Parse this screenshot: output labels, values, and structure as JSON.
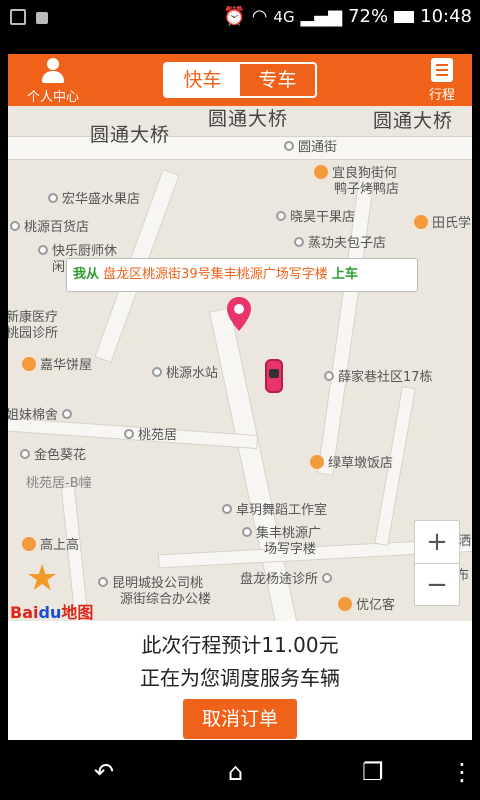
{
  "status_bar": {
    "network": "4G",
    "battery": "72%",
    "time": "10:48"
  },
  "header": {
    "profile_label": "个人中心",
    "trips_label": "行程",
    "tabs": [
      {
        "label": "快车",
        "active": true
      },
      {
        "label": "专车",
        "active": false
      }
    ],
    "accent_color": "#f0621a"
  },
  "map": {
    "road_labels": [
      "圆通大桥",
      "圆通大桥",
      "圆通大桥"
    ],
    "pois": [
      "圆通街",
      "宜良狗街何",
      "鸭子烤鸭店",
      "宏华盛水果店",
      "晓昊干果店",
      "田氏学",
      "桃源百货店",
      "蒸功夫包子店",
      "快乐厨师休",
      "闲",
      "新康医疗",
      "桃园诊所",
      "嘉华饼屋",
      "桃源水站",
      "薛家巷社区17栋",
      "姐妹棉舍",
      "桃苑居",
      "金色葵花",
      "绿草墩饭店",
      "桃苑居-B幢",
      "卓玥舞蹈工作室",
      "集丰桃源广",
      "场写字楼",
      "高上高",
      "昆明城投公司桃",
      "源街综合办公楼",
      "盘龙杨途诊所",
      "优亿客",
      "布",
      "洒"
    ],
    "pickup": {
      "prefix": "我从",
      "address": "盘龙区桃源街39号集丰桃源广场写字楼",
      "suffix": "上车"
    },
    "zoom_in": "+",
    "zoom_out": "−",
    "logo": {
      "bai": "Bai",
      "du": "du",
      "map": "地图"
    }
  },
  "panel": {
    "fare_text": "此次行程预计11.00元",
    "status_text": "正在为您调度服务车辆",
    "cancel_label": "取消订单"
  },
  "navbar": {
    "back": "↶",
    "home": "⌂",
    "recents": "❐",
    "menu": "⋮"
  }
}
